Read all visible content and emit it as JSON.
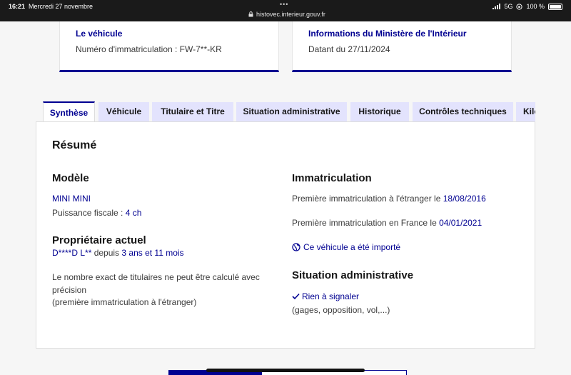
{
  "status": {
    "time": "16:21",
    "date": "Mercredi 27 novembre",
    "url": "histovec.interieur.gouv.fr",
    "network": "5G",
    "battery": "100 %"
  },
  "cards": {
    "vehicle": {
      "title": "Le véhicule",
      "body": "Numéro d'immatriculation : FW-7**-KR"
    },
    "ministry": {
      "title": "Informations du Ministère de l'Intérieur",
      "body": "Datant du 27/11/2024"
    }
  },
  "tabs": [
    "Synthèse",
    "Véhicule",
    "Titulaire et Titre",
    "Situation administrative",
    "Historique",
    "Contrôles techniques",
    "Kilo"
  ],
  "summary": {
    "heading": "Résumé",
    "model": {
      "heading": "Modèle",
      "name": "MINI MINI",
      "power_label": "Puissance fiscale : ",
      "power_value": "4 ch"
    },
    "owner": {
      "heading": "Propriétaire actuel",
      "name": "D****D L**",
      "since_label": " depuis ",
      "since_value": "3 ans et 11 mois",
      "note_line1": "Le nombre exact de titulaires ne peut être calculé avec",
      "note_line2": "précision",
      "note_line3": "(première immatriculation à l'étranger)"
    },
    "registration": {
      "heading": "Immatriculation",
      "foreign_label": "Première immatriculation à l'étranger le ",
      "foreign_date": "18/08/2016",
      "france_label": "Première immatriculation en France le ",
      "france_date": "04/01/2021",
      "imported": "Ce véhicule a été importé"
    },
    "admin": {
      "heading": "Situation administrative",
      "status": "Rien à signaler",
      "detail": "(gages, opposition, vol,...)"
    }
  }
}
